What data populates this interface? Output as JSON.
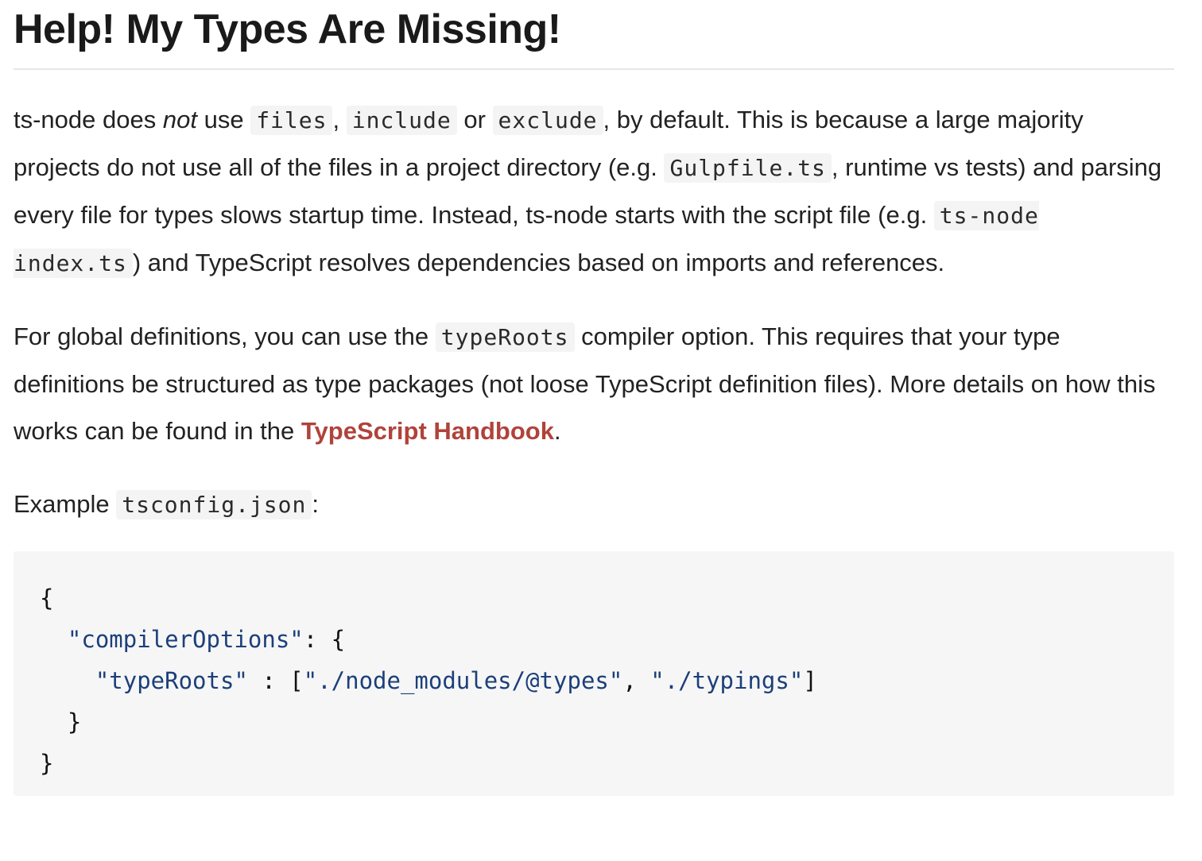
{
  "heading": "Help! My Types Are Missing!",
  "para1": {
    "t1": "ts-node does ",
    "em": "not",
    "t2": " use ",
    "c1": "files",
    "t3": ", ",
    "c2": "include",
    "t4": " or ",
    "c3": "exclude",
    "t5": ", by default. This is because a large majority projects do not use all of the files in a project directory (e.g. ",
    "c4": "Gulpfile.ts",
    "t6": ", runtime vs tests) and parsing every file for types slows startup time. Instead, ts-node starts with the script file (e.g. ",
    "c5": "ts-node index.ts",
    "t7": ") and TypeScript resolves dependencies based on imports and references."
  },
  "para2": {
    "t1": "For global definitions, you can use the ",
    "c1": "typeRoots",
    "t2": " compiler option. This requires that your type definitions be structured as type packages (not loose TypeScript definition files). More details on how this works can be found in the ",
    "link": "TypeScript Handbook",
    "t3": "."
  },
  "para3": {
    "t1": "Example ",
    "c1": "tsconfig.json",
    "t2": ":"
  },
  "code": {
    "open_brace": "{",
    "compiler_key": "\"compilerOptions\"",
    "compiler_sep": ": {",
    "typeroots_key": "\"typeRoots\"",
    "typeroots_sep": " : [",
    "val1": "\"./node_modules/@types\"",
    "comma": ", ",
    "val2": "\"./typings\"",
    "close_bracket": "]",
    "inner_close": "}",
    "outer_close": "}"
  },
  "colors": {
    "link": "#b0433b",
    "code_string": "#1c3f7a",
    "code_bg": "#f6f6f6"
  }
}
